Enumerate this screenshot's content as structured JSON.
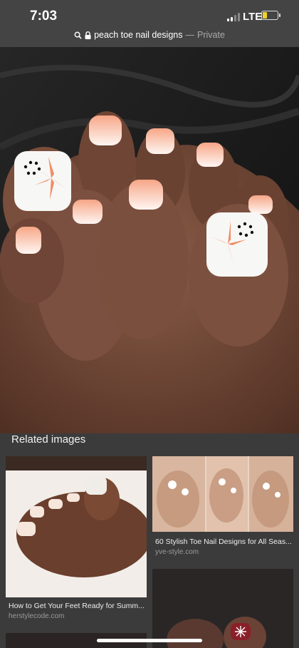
{
  "status_bar": {
    "time": "7:03",
    "network": "LTE",
    "battery_level": 0.3
  },
  "url_bar": {
    "query": "peach toe nail designs",
    "separator": "—",
    "mode": "Private"
  },
  "related": {
    "heading": "Related images",
    "cards": [
      {
        "title": "How to Get Your Feet Ready for Summ...",
        "source": "herstylecode.com"
      },
      {
        "title": "60 Stylish Toe Nail Designs for All Seas...",
        "source": "yve-style.com"
      }
    ]
  },
  "icons": {
    "search": "search-icon",
    "lock": "lock-icon"
  }
}
